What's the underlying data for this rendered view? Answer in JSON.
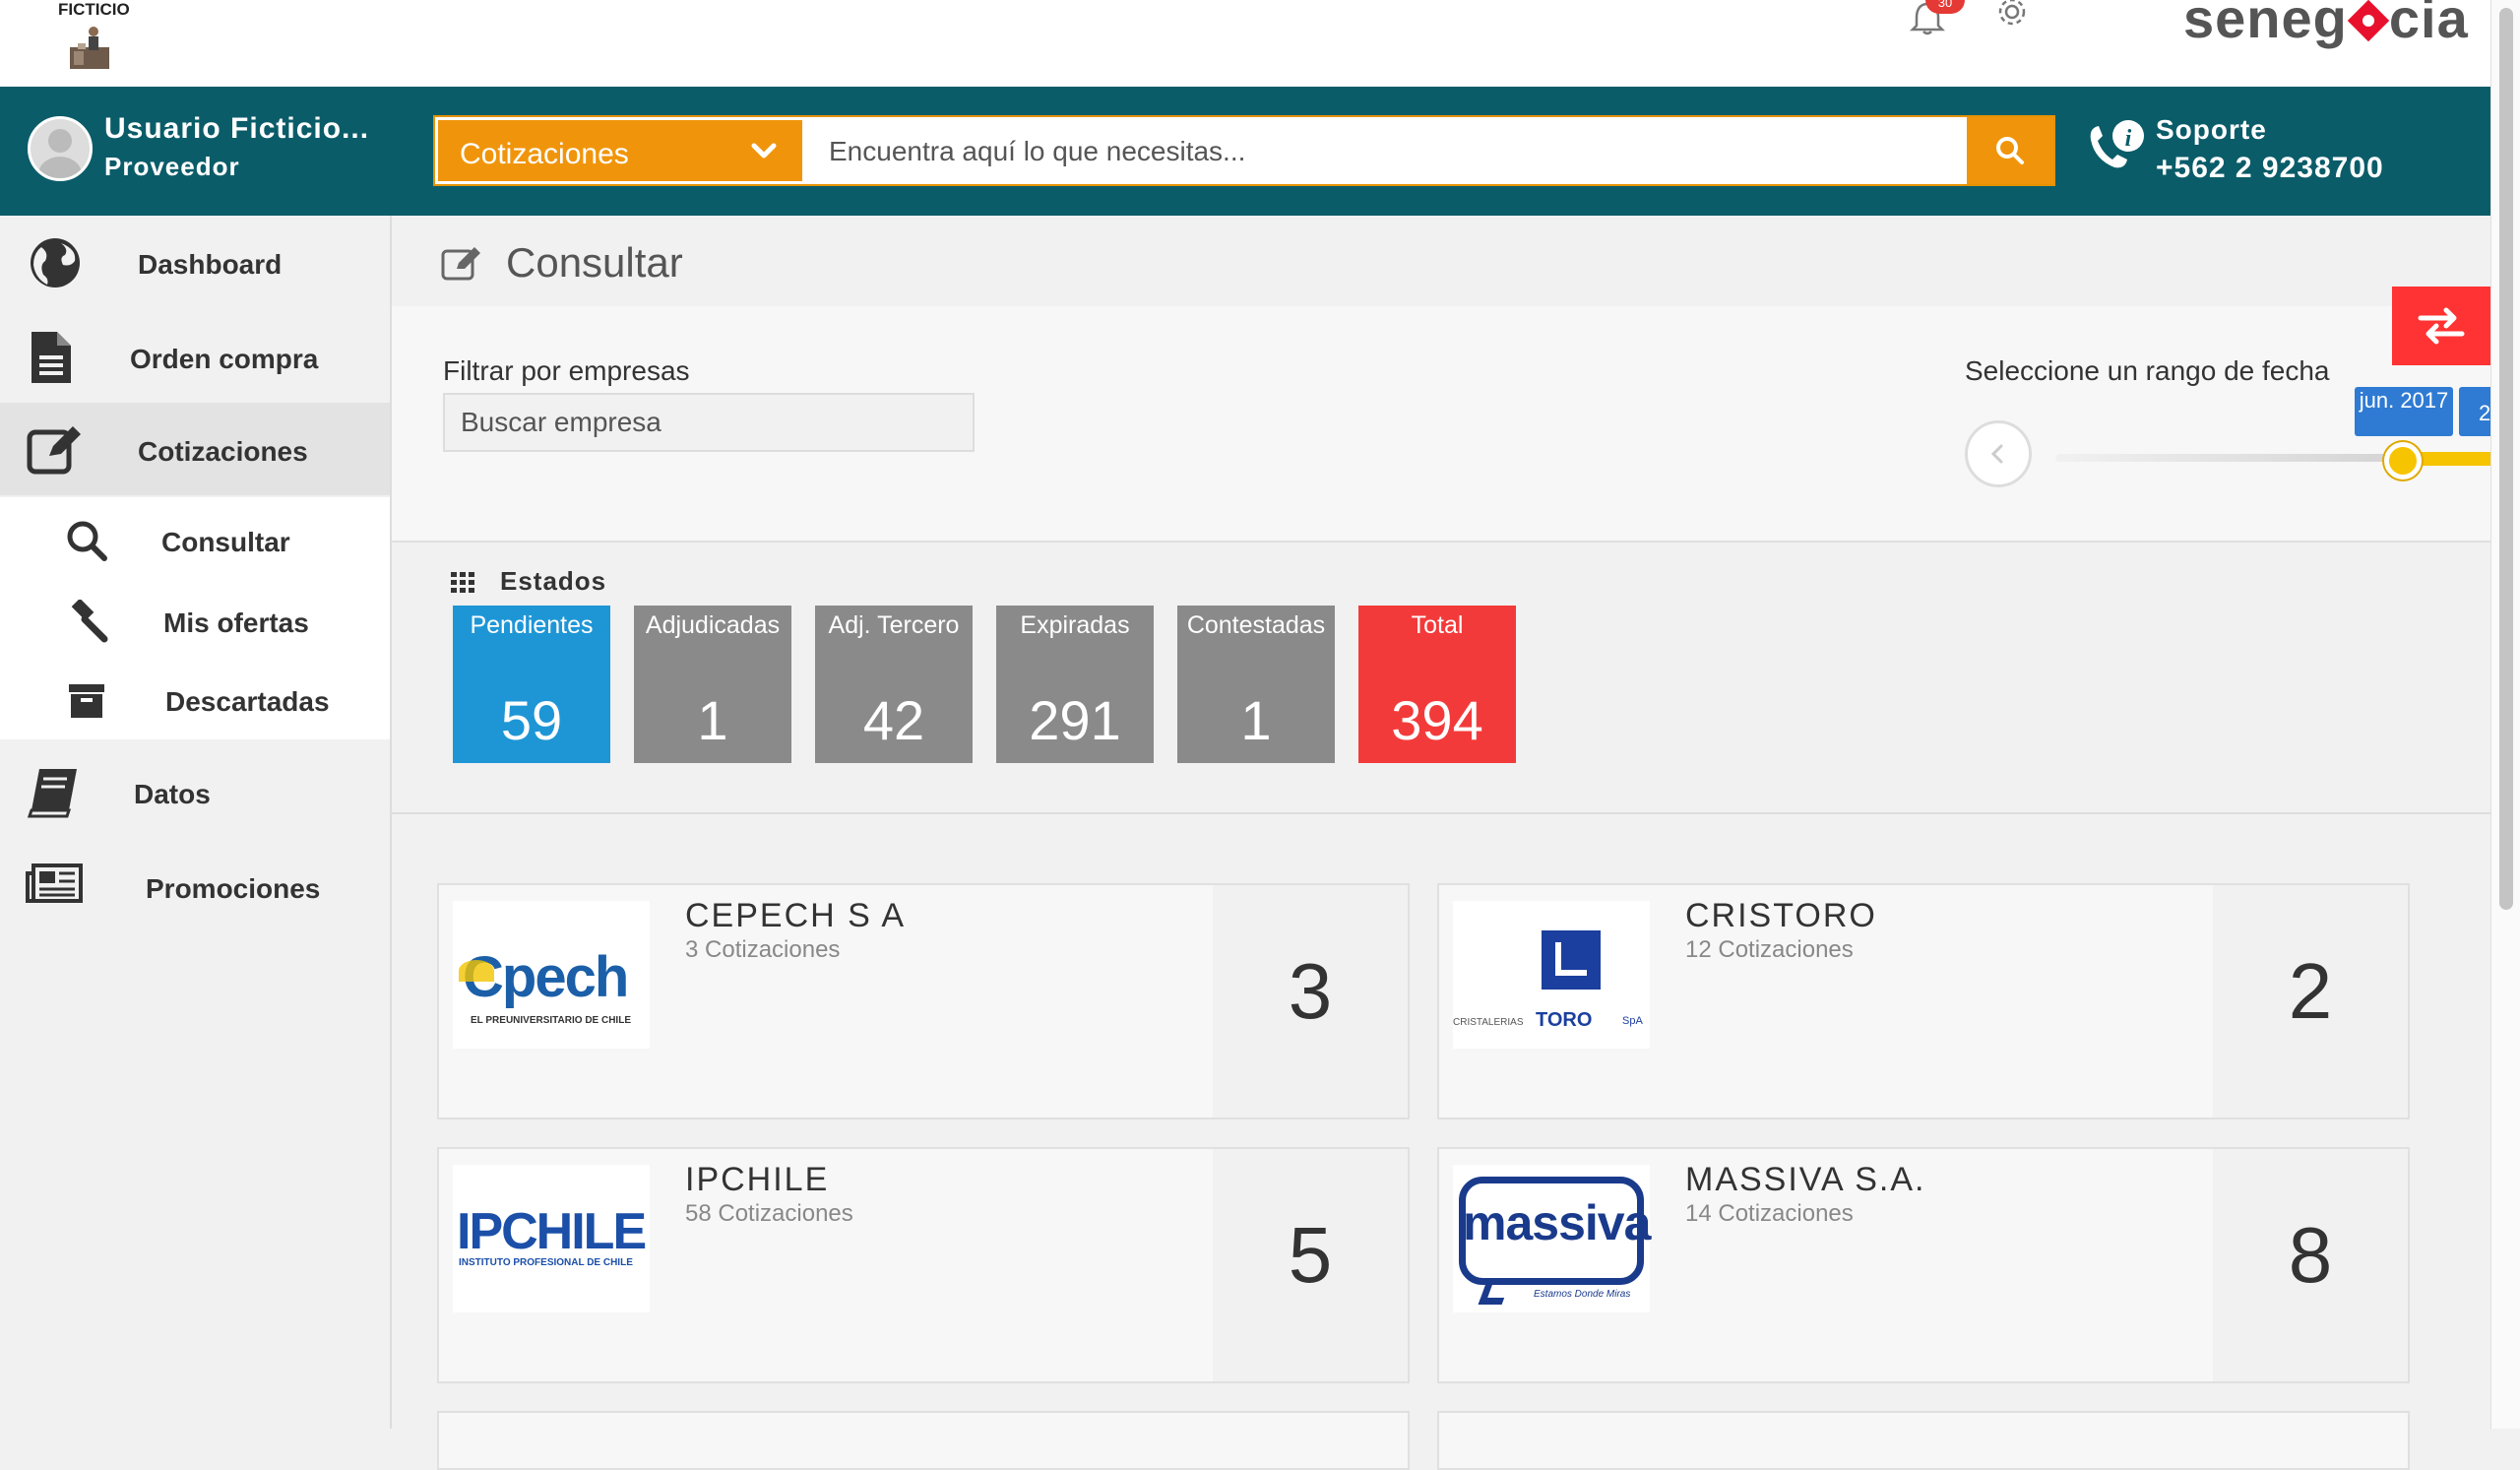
{
  "topbar": {
    "logo_text": "FICTICIO",
    "notification_count": "30",
    "brand_prefix": "seneg",
    "brand_suffix": "cia"
  },
  "header": {
    "user_name": "Usuario Ficticio...",
    "user_role": "Proveedor",
    "search_category": "Cotizaciones",
    "search_placeholder": "Encuentra aquí lo que necesitas...",
    "support_label": "Soporte",
    "support_phone": "+562 2 9238700"
  },
  "sidebar": {
    "items": [
      {
        "label": "Dashboard",
        "icon": "globe-icon"
      },
      {
        "label": "Orden compra",
        "icon": "document-icon"
      },
      {
        "label": "Cotizaciones",
        "icon": "edit-icon"
      },
      {
        "label": "Datos",
        "icon": "book-icon"
      },
      {
        "label": "Promociones",
        "icon": "newspaper-icon"
      }
    ],
    "subitems": [
      {
        "label": "Consultar",
        "icon": "search-icon"
      },
      {
        "label": "Mis ofertas",
        "icon": "gavel-icon"
      },
      {
        "label": "Descartadas",
        "icon": "archive-icon"
      }
    ]
  },
  "main": {
    "page_title": "Consultar",
    "filter_label": "Filtrar por empresas",
    "filter_placeholder": "Buscar empresa",
    "date_label": "Seleccione un rango de fecha",
    "date_tag": "jun. 2017",
    "date_tag_next": "2",
    "states_title": "Estados",
    "states": [
      {
        "label": "Pendientes",
        "value": "59",
        "color": "#1e96d6"
      },
      {
        "label": "Adjudicadas",
        "value": "1",
        "color": "#8a8a8a"
      },
      {
        "label": "Adj. Tercero",
        "value": "42",
        "color": "#8a8a8a"
      },
      {
        "label": "Expiradas",
        "value": "291",
        "color": "#8a8a8a"
      },
      {
        "label": "Contestadas",
        "value": "1",
        "color": "#8a8a8a"
      },
      {
        "label": "Total",
        "value": "394",
        "color": "#f33a3a"
      }
    ],
    "companies": [
      {
        "name": "CEPECH S A",
        "subtitle": "3 Cotizaciones",
        "count": "3",
        "logo_main": "Cpech",
        "logo_tag": "EL PREUNIVERSITARIO DE CHILE"
      },
      {
        "name": "CRISTORO",
        "subtitle": "12 Cotizaciones",
        "count": "2",
        "logo_main": "TORO",
        "logo_tag": "CRISTALERIAS",
        "logo_suffix": "SpA"
      },
      {
        "name": "IPCHILE",
        "subtitle": "58 Cotizaciones",
        "count": "5",
        "logo_main": "IPCHILE",
        "logo_tag": "INSTITUTO PROFESIONAL DE CHILE"
      },
      {
        "name": "MASSIVA S.A.",
        "subtitle": "14 Cotizaciones",
        "count": "8",
        "logo_main": "massiva",
        "logo_tag": "Estamos Donde Miras"
      }
    ]
  }
}
